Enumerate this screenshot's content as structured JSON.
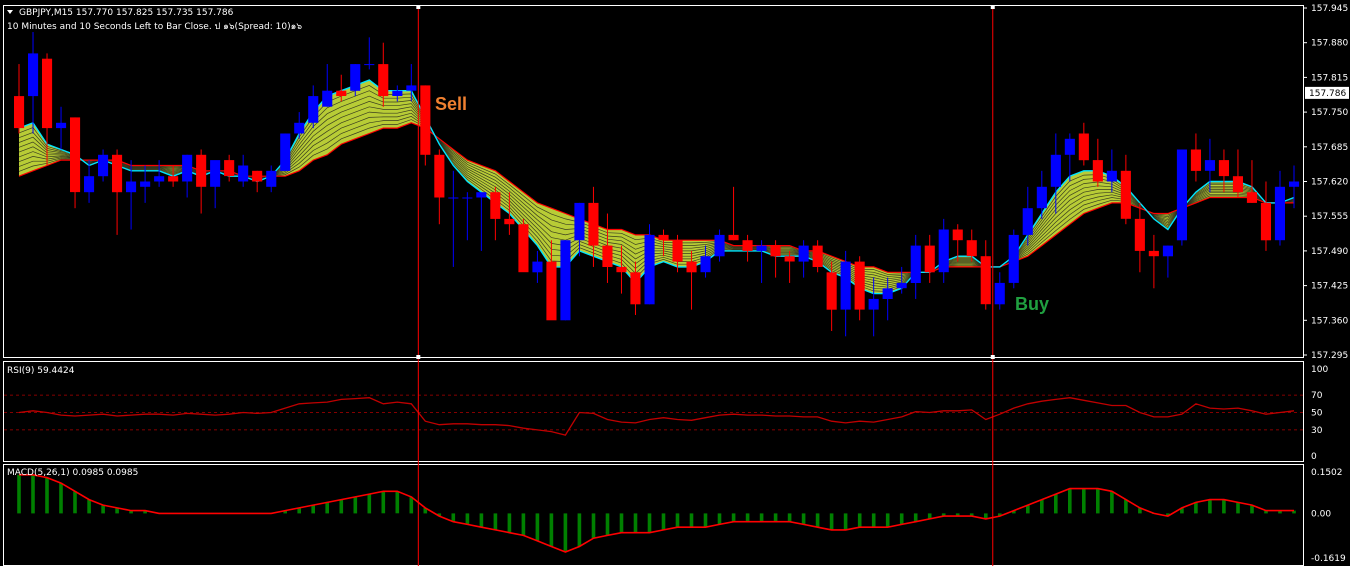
{
  "header": {
    "symbol_line": "GBPJPY,M15  157.770 157.825 157.735 157.786",
    "timer_line": "10 Minutes and 10 Seconds Left to Bar Close. ป ๑๖(Spread: 10)๑๖"
  },
  "annotations": {
    "sell": "Sell",
    "buy": "Buy"
  },
  "colors": {
    "bull": "#0000ff",
    "bear": "#ff0000",
    "background": "#000000",
    "ribbon_fast": "#00e5ff",
    "ribbon_slow": "#ff0000",
    "ribbon_fill": "#d8f040",
    "rsi_line": "#c00000",
    "macd_hist": "#008000",
    "macd_signal": "#ff0000",
    "signal_line": "#ff0000",
    "sell_text": "#f08030",
    "buy_text": "#20a040"
  },
  "chart_data": [
    {
      "type": "candlestick",
      "title": "GBPJPY,M15",
      "price_axis_labels": [
        "157.945",
        "157.880",
        "157.815",
        "157.750",
        "157.685",
        "157.620",
        "157.555",
        "157.490",
        "157.425",
        "157.360",
        "157.295"
      ],
      "current_price": "157.786",
      "ylim": [
        157.295,
        157.945
      ],
      "candles": [
        [
          157.78,
          157.84,
          157.71,
          157.72
        ],
        [
          157.78,
          157.9,
          157.71,
          157.86
        ],
        [
          157.85,
          157.86,
          157.65,
          157.72
        ],
        [
          157.72,
          157.76,
          157.68,
          157.73
        ],
        [
          157.74,
          157.74,
          157.57,
          157.6
        ],
        [
          157.6,
          157.66,
          157.58,
          157.63
        ],
        [
          157.63,
          157.68,
          157.62,
          157.67
        ],
        [
          157.67,
          157.68,
          157.52,
          157.6
        ],
        [
          157.6,
          157.66,
          157.53,
          157.62
        ],
        [
          157.61,
          157.65,
          157.58,
          157.62
        ],
        [
          157.62,
          157.66,
          157.61,
          157.63
        ],
        [
          157.63,
          157.65,
          157.61,
          157.62
        ],
        [
          157.62,
          157.67,
          157.59,
          157.67
        ],
        [
          157.67,
          157.68,
          157.56,
          157.61
        ],
        [
          157.61,
          157.65,
          157.57,
          157.66
        ],
        [
          157.66,
          157.67,
          157.62,
          157.63
        ],
        [
          157.62,
          157.67,
          157.61,
          157.65
        ],
        [
          157.64,
          157.64,
          157.6,
          157.62
        ],
        [
          157.61,
          157.65,
          157.6,
          157.64
        ],
        [
          157.64,
          157.71,
          157.64,
          157.71
        ],
        [
          157.71,
          157.75,
          157.7,
          157.73
        ],
        [
          157.73,
          157.8,
          157.72,
          157.78
        ],
        [
          157.76,
          157.84,
          157.76,
          157.79
        ],
        [
          157.79,
          157.82,
          157.77,
          157.78
        ],
        [
          157.79,
          157.84,
          157.78,
          157.84
        ],
        [
          157.84,
          157.89,
          157.83,
          157.84
        ],
        [
          157.84,
          157.88,
          157.76,
          157.78
        ],
        [
          157.78,
          157.8,
          157.77,
          157.79
        ],
        [
          157.79,
          157.84,
          157.77,
          157.8
        ],
        [
          157.8,
          157.8,
          157.65,
          157.67
        ],
        [
          157.67,
          157.68,
          157.54,
          157.59
        ],
        [
          157.59,
          157.64,
          157.46,
          157.59
        ],
        [
          157.59,
          157.6,
          157.51,
          157.59
        ],
        [
          157.59,
          157.59,
          157.49,
          157.6
        ],
        [
          157.6,
          157.61,
          157.51,
          157.55
        ],
        [
          157.55,
          157.6,
          157.52,
          157.54
        ],
        [
          157.54,
          157.55,
          157.47,
          157.45
        ],
        [
          157.45,
          157.49,
          157.43,
          157.47
        ],
        [
          157.47,
          157.51,
          157.39,
          157.36
        ],
        [
          157.36,
          157.51,
          157.36,
          157.51
        ],
        [
          157.51,
          157.58,
          157.48,
          157.58
        ],
        [
          157.58,
          157.61,
          157.46,
          157.5
        ],
        [
          157.5,
          157.56,
          157.43,
          157.46
        ],
        [
          157.46,
          157.5,
          157.41,
          157.45
        ],
        [
          157.45,
          157.47,
          157.37,
          157.39
        ],
        [
          157.39,
          157.54,
          157.39,
          157.52
        ],
        [
          157.52,
          157.53,
          157.48,
          157.51
        ],
        [
          157.51,
          157.52,
          157.45,
          157.47
        ],
        [
          157.47,
          157.49,
          157.38,
          157.45
        ],
        [
          157.45,
          157.5,
          157.44,
          157.48
        ],
        [
          157.48,
          157.53,
          157.47,
          157.52
        ],
        [
          157.52,
          157.61,
          157.51,
          157.51
        ],
        [
          157.51,
          157.52,
          157.47,
          157.49
        ],
        [
          157.49,
          157.51,
          157.43,
          157.5
        ],
        [
          157.5,
          157.51,
          157.44,
          157.48
        ],
        [
          157.48,
          157.49,
          157.43,
          157.47
        ],
        [
          157.47,
          157.51,
          157.44,
          157.5
        ],
        [
          157.5,
          157.51,
          157.45,
          157.46
        ],
        [
          157.45,
          157.47,
          157.34,
          157.38
        ],
        [
          157.38,
          157.49,
          157.33,
          157.47
        ],
        [
          157.47,
          157.48,
          157.36,
          157.38
        ],
        [
          157.38,
          157.44,
          157.33,
          157.4
        ],
        [
          157.4,
          157.44,
          157.36,
          157.42
        ],
        [
          157.42,
          157.46,
          157.41,
          157.43
        ],
        [
          157.43,
          157.52,
          157.4,
          157.5
        ],
        [
          157.5,
          157.52,
          157.43,
          157.45
        ],
        [
          157.45,
          157.55,
          157.43,
          157.53
        ],
        [
          157.53,
          157.54,
          157.47,
          157.51
        ],
        [
          157.51,
          157.53,
          157.47,
          157.48
        ],
        [
          157.48,
          157.51,
          157.38,
          157.39
        ],
        [
          157.39,
          157.45,
          157.38,
          157.43
        ],
        [
          157.43,
          157.53,
          157.42,
          157.52
        ],
        [
          157.52,
          157.61,
          157.5,
          157.57
        ],
        [
          157.57,
          157.64,
          157.55,
          157.61
        ],
        [
          157.61,
          157.71,
          157.56,
          157.67
        ],
        [
          157.67,
          157.71,
          157.62,
          157.7
        ],
        [
          157.71,
          157.73,
          157.65,
          157.66
        ],
        [
          157.66,
          157.7,
          157.61,
          157.62
        ],
        [
          157.62,
          157.68,
          157.6,
          157.64
        ],
        [
          157.64,
          157.67,
          157.54,
          157.55
        ],
        [
          157.55,
          157.58,
          157.45,
          157.49
        ],
        [
          157.49,
          157.52,
          157.42,
          157.48
        ],
        [
          157.48,
          157.5,
          157.44,
          157.5
        ],
        [
          157.51,
          157.68,
          157.5,
          157.68
        ],
        [
          157.68,
          157.71,
          157.62,
          157.64
        ],
        [
          157.64,
          157.7,
          157.6,
          157.66
        ],
        [
          157.66,
          157.68,
          157.6,
          157.63
        ],
        [
          157.63,
          157.68,
          157.59,
          157.6
        ],
        [
          157.6,
          157.66,
          157.58,
          157.58
        ],
        [
          157.58,
          157.62,
          157.49,
          157.51
        ],
        [
          157.51,
          157.64,
          157.5,
          157.61
        ],
        [
          157.61,
          157.65,
          157.57,
          157.62
        ]
      ],
      "ribbon": {
        "fast": [
          157.72,
          157.73,
          157.69,
          157.68,
          157.67,
          157.65,
          157.66,
          157.65,
          157.64,
          157.64,
          157.64,
          157.63,
          157.64,
          157.63,
          157.64,
          157.63,
          157.63,
          157.62,
          157.63,
          157.66,
          157.71,
          157.75,
          157.78,
          157.79,
          157.8,
          157.81,
          157.79,
          157.79,
          157.79,
          157.74,
          157.69,
          157.65,
          157.62,
          157.6,
          157.58,
          157.56,
          157.53,
          157.5,
          157.46,
          157.46,
          157.49,
          157.48,
          157.47,
          157.46,
          157.43,
          157.46,
          157.47,
          157.46,
          157.46,
          157.47,
          157.49,
          157.49,
          157.49,
          157.49,
          157.48,
          157.48,
          157.48,
          157.47,
          157.45,
          157.44,
          157.42,
          157.41,
          157.41,
          157.42,
          157.45,
          157.45,
          157.47,
          157.48,
          157.48,
          157.46,
          157.46,
          157.48,
          157.52,
          157.56,
          157.6,
          157.63,
          157.64,
          157.64,
          157.63,
          157.61,
          157.58,
          157.55,
          157.53,
          157.57,
          157.6,
          157.62,
          157.62,
          157.62,
          157.61,
          157.58,
          157.58,
          157.59
        ],
        "slow": [
          157.63,
          157.64,
          157.65,
          157.66,
          157.66,
          157.66,
          157.66,
          157.66,
          157.65,
          157.65,
          157.65,
          157.65,
          157.65,
          157.64,
          157.64,
          157.64,
          157.63,
          157.63,
          157.63,
          157.63,
          157.64,
          157.66,
          157.67,
          157.69,
          157.7,
          157.71,
          157.72,
          157.72,
          157.73,
          157.72,
          157.7,
          157.68,
          157.66,
          157.65,
          157.64,
          157.62,
          157.6,
          157.58,
          157.57,
          157.56,
          157.55,
          157.54,
          157.53,
          157.53,
          157.52,
          157.52,
          157.51,
          157.51,
          157.51,
          157.51,
          157.51,
          157.5,
          157.5,
          157.5,
          157.5,
          157.5,
          157.49,
          157.49,
          157.48,
          157.47,
          157.46,
          157.46,
          157.45,
          157.45,
          157.45,
          157.45,
          157.46,
          157.46,
          157.46,
          157.46,
          157.46,
          157.47,
          157.48,
          157.5,
          157.52,
          157.54,
          157.56,
          157.57,
          157.58,
          157.58,
          157.57,
          157.56,
          157.56,
          157.57,
          157.58,
          157.59,
          157.59,
          157.59,
          157.59,
          157.58,
          157.58,
          157.58
        ]
      },
      "signals": [
        {
          "label": "Sell",
          "candle_index": 28.5
        },
        {
          "label": "Buy",
          "candle_index": 69.5
        }
      ]
    },
    {
      "type": "line",
      "title": "RSI(9) 59.4424",
      "ylim": [
        0,
        100
      ],
      "axis_labels": [
        "100",
        "70",
        "50",
        "30",
        "0"
      ],
      "levels": [
        70,
        50,
        30
      ],
      "values": [
        50,
        52,
        50,
        47,
        46,
        47,
        48,
        46,
        47,
        48,
        48,
        47,
        49,
        48,
        47,
        48,
        50,
        49,
        50,
        55,
        60,
        61,
        62,
        65,
        66,
        67,
        60,
        62,
        60,
        40,
        36,
        37,
        37,
        36,
        36,
        35,
        32,
        30,
        28,
        24,
        50,
        49,
        42,
        39,
        38,
        42,
        44,
        42,
        41,
        44,
        47,
        48,
        47,
        47,
        46,
        46,
        45,
        45,
        40,
        38,
        40,
        39,
        42,
        45,
        51,
        50,
        52,
        52,
        53,
        42,
        48,
        55,
        60,
        63,
        65,
        67,
        64,
        61,
        58,
        58,
        50,
        45,
        45,
        48,
        60,
        55,
        54,
        55,
        52,
        48,
        50,
        52
      ]
    },
    {
      "type": "bar",
      "title": "MACD(5,26,1) 0.0985 0.0985",
      "ylim": [
        -0.1619,
        0.1502
      ],
      "axis_labels": [
        "0.1502",
        "0.00",
        "-0.1619"
      ],
      "histogram": [
        0.14,
        0.14,
        0.13,
        0.11,
        0.08,
        0.05,
        0.03,
        0.02,
        0.01,
        0.01,
        0.0,
        0.0,
        0.0,
        0.0,
        0.0,
        0.0,
        0.0,
        0.0,
        0.0,
        0.01,
        0.02,
        0.03,
        0.04,
        0.05,
        0.06,
        0.07,
        0.08,
        0.08,
        0.06,
        0.02,
        -0.01,
        -0.03,
        -0.04,
        -0.05,
        -0.06,
        -0.07,
        -0.08,
        -0.1,
        -0.12,
        -0.14,
        -0.12,
        -0.09,
        -0.08,
        -0.07,
        -0.07,
        -0.07,
        -0.06,
        -0.05,
        -0.05,
        -0.05,
        -0.04,
        -0.03,
        -0.03,
        -0.03,
        -0.03,
        -0.03,
        -0.04,
        -0.05,
        -0.06,
        -0.06,
        -0.05,
        -0.05,
        -0.05,
        -0.04,
        -0.03,
        -0.02,
        -0.01,
        -0.01,
        -0.01,
        -0.02,
        -0.01,
        0.01,
        0.03,
        0.05,
        0.07,
        0.09,
        0.09,
        0.09,
        0.08,
        0.05,
        0.02,
        0.0,
        -0.01,
        0.02,
        0.04,
        0.05,
        0.05,
        0.04,
        0.03,
        0.01,
        0.01,
        0.01
      ],
      "signal": [
        0.14,
        0.14,
        0.13,
        0.11,
        0.08,
        0.05,
        0.03,
        0.02,
        0.01,
        0.01,
        0.0,
        0.0,
        0.0,
        0.0,
        0.0,
        0.0,
        0.0,
        0.0,
        0.0,
        0.01,
        0.02,
        0.03,
        0.04,
        0.05,
        0.06,
        0.07,
        0.08,
        0.08,
        0.06,
        0.02,
        -0.01,
        -0.03,
        -0.04,
        -0.05,
        -0.06,
        -0.07,
        -0.08,
        -0.1,
        -0.12,
        -0.14,
        -0.12,
        -0.09,
        -0.08,
        -0.07,
        -0.07,
        -0.07,
        -0.06,
        -0.05,
        -0.05,
        -0.05,
        -0.04,
        -0.03,
        -0.03,
        -0.03,
        -0.03,
        -0.03,
        -0.04,
        -0.05,
        -0.06,
        -0.06,
        -0.05,
        -0.05,
        -0.05,
        -0.04,
        -0.03,
        -0.02,
        -0.01,
        -0.01,
        -0.01,
        -0.02,
        -0.01,
        0.01,
        0.03,
        0.05,
        0.07,
        0.09,
        0.09,
        0.09,
        0.08,
        0.05,
        0.02,
        0.0,
        -0.01,
        0.02,
        0.04,
        0.05,
        0.05,
        0.04,
        0.03,
        0.01,
        0.01,
        0.01
      ]
    }
  ]
}
